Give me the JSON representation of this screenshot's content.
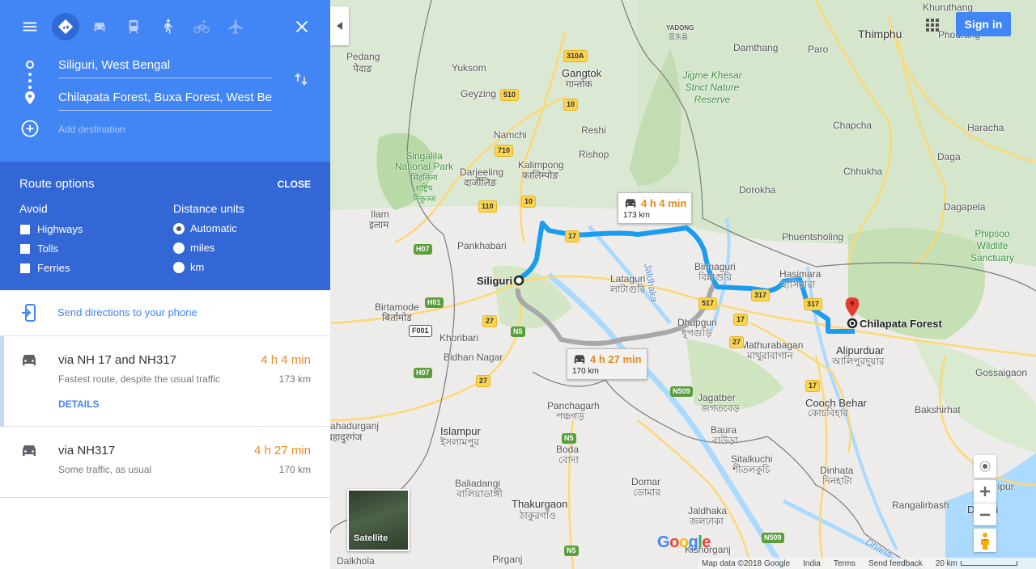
{
  "directions": {
    "modes": [
      "Best travel modes",
      "Driving",
      "Transit",
      "Walking",
      "Cycling",
      "Flights"
    ],
    "origin": "Siliguri, West Bengal",
    "destination": "Chilapata Forest, Buxa Forest, West Ben",
    "add_destination": "Add destination"
  },
  "route_options": {
    "title": "Route options",
    "close_label": "CLOSE",
    "avoid_label": "Avoid",
    "avoid": [
      {
        "label": "Highways",
        "checked": false
      },
      {
        "label": "Tolls",
        "checked": false
      },
      {
        "label": "Ferries",
        "checked": false
      }
    ],
    "units_label": "Distance units",
    "units": [
      {
        "label": "Automatic",
        "selected": true
      },
      {
        "label": "miles",
        "selected": false
      },
      {
        "label": "km",
        "selected": false
      }
    ]
  },
  "send_directions": "Send directions to your phone",
  "routes": [
    {
      "name": "via NH 17 and NH317",
      "description": "Fastest route, despite the usual traffic",
      "time": "4 h 4 min",
      "distance": "173 km",
      "details": "DETAILS"
    },
    {
      "name": "via NH317",
      "description": "Some traffic, as usual",
      "time": "4 h 27 min",
      "distance": "170 km"
    }
  ],
  "map": {
    "sign_in": "Sign in",
    "satellite": "Satellite",
    "google_logo": [
      "G",
      "o",
      "o",
      "g",
      "l",
      "e"
    ],
    "google_colors": [
      "#4285f4",
      "#ea4335",
      "#fbbc05",
      "#4285f4",
      "#34a853",
      "#ea4335"
    ],
    "footer": {
      "map_data": "Map data ©2018 Google",
      "country": "India",
      "terms": "Terms",
      "feedback": "Send feedback",
      "scale": "20 km"
    },
    "callouts": [
      {
        "time": "4 h 4 min",
        "distance": "173 km"
      },
      {
        "time": "4 h 27 min",
        "distance": "170 km"
      }
    ],
    "markers": {
      "origin": "Siliguri",
      "destination": "Chilapata Forest"
    },
    "route_color": "#1a9cf0",
    "alt_route_color": "#a8a8a8",
    "labels": [
      "Pedang",
      "पेदाङ",
      "Yuksom",
      "Geyzing",
      "Gangtok",
      "गान्तोक",
      "Namchi",
      "Reshi",
      "Rishop",
      "Kalimpong",
      "कालिम्पोङ",
      "Darjeeling",
      "दार्जीलिङ",
      "Singalila National Park",
      "सिंहलिला राष्ट्रिय निकुञ्ज",
      "Ilam",
      "इलाम",
      "Pankhabari",
      "Birtamode",
      "बिर्तामोड",
      "Khoribari",
      "Bidhan Nagar",
      "Lataguri",
      "লাটাগুরি",
      "Jaldhaka",
      "Binnaguri",
      "বিন্নাগুরি",
      "Dhupguri",
      "ধূপগুড়ি",
      "Hasimara",
      "হাসিমারা",
      "Mathurabagan",
      "মাথুরাবাগান",
      "Alipurduar",
      "আলিপুরদুয়ার",
      "Cooch Behar",
      "কোচবিহার",
      "Jagatber",
      "জগতবেড়",
      "Baura",
      "বাউড়া",
      "Sitalkuchi",
      "শীতলকুচি",
      "Dinhata",
      "দিনহাটা",
      "Bakshirhat",
      "Gossaigaon",
      "Gauripur",
      "Dhubri",
      "Rangalirbash",
      "Panchagarh",
      "পঞ্চগড়",
      "Boda",
      "বোদা",
      "Domar",
      "ডোমার",
      "Jaldhaka",
      "জলঢাকা",
      "Thakurgaon",
      "ঠাকুরগাঁও",
      "Baliadangi",
      "বালিয়াডাঙ্গী",
      "Islampur",
      "ইসলামপুর",
      "Bahadurganj",
      "बहादुरगंज",
      "Dalkhola",
      "Pirganj",
      "Kishorganj",
      "YADONG",
      "亚东县",
      "Damthang",
      "Paro",
      "Thimphu",
      "Khuruthang",
      "Phodrang",
      "Jigme Khesar Strict Nature Reserve",
      "Chapcha",
      "Haracha",
      "Chhukha",
      "Daga",
      "Dorokha",
      "Dagapela",
      "Phuentsholing",
      "Phipsoo Wildlife Sanctuary",
      "Dharla"
    ],
    "shields": [
      "310A",
      "510",
      "10",
      "710",
      "10",
      "110",
      "17",
      "27",
      "27",
      "517",
      "317",
      "317",
      "17",
      "27",
      "17",
      "N5",
      "N5",
      "N5",
      "N509",
      "N509",
      "H07",
      "H07",
      "H01",
      "F001"
    ]
  }
}
